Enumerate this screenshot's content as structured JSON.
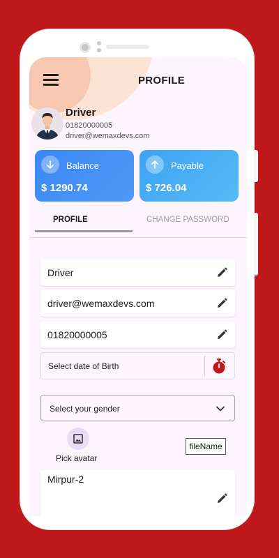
{
  "header": {
    "title": "PROFILE",
    "menu_icon": "hamburger-menu-icon"
  },
  "user": {
    "name": "Driver",
    "phone": "01820000005",
    "email": "driver@wemaxdevs.com",
    "avatar_icon": "driver-avatar"
  },
  "cards": {
    "balance": {
      "label": "Balance",
      "value": "$ 1290.74",
      "icon": "arrow-down-icon",
      "color": "#3a87f4"
    },
    "payable": {
      "label": "Payable",
      "value": "$ 726.04",
      "icon": "arrow-up-icon",
      "color": "#3ea4f4"
    }
  },
  "tabs": [
    {
      "label": "PROFILE",
      "active": true
    },
    {
      "label": "CHANGE PASSWORD",
      "active": false
    }
  ],
  "form": {
    "name": "Driver",
    "email": "driver@wemaxdevs.com",
    "phone": "01820000005",
    "dob_placeholder": "Select date of Birth",
    "gender_placeholder": "Select your gender",
    "pick_avatar_label": "Pick avatar",
    "file_name": "fileName",
    "address": "Mirpur-2"
  },
  "colors": {
    "background": "#c0191b",
    "screen": "#fcf5fd",
    "accent_blob": "#f8c8b0",
    "timer": "#c0191b"
  }
}
